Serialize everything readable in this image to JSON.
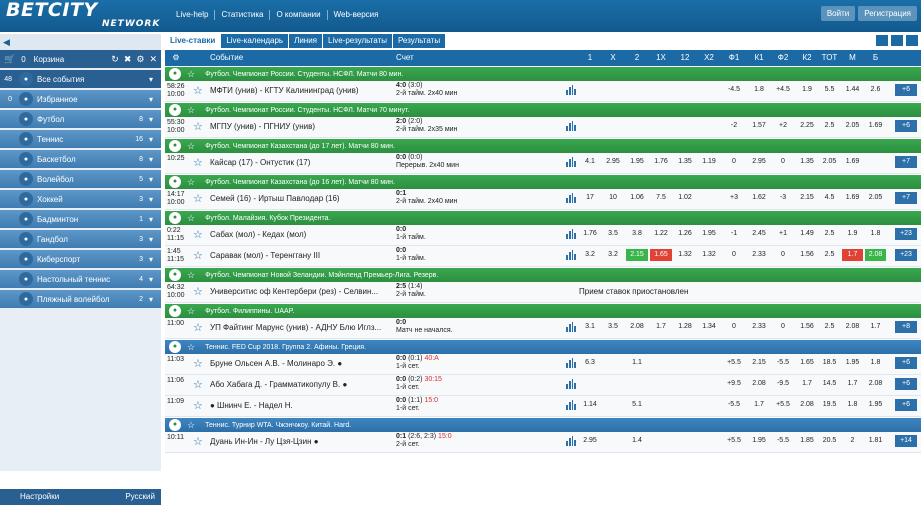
{
  "brand": {
    "name": "BETCITY",
    "sub": "NETWORK"
  },
  "topnav": [
    "Live-help",
    "Статистика",
    "О компании",
    "Web-версия"
  ],
  "auth": {
    "login": "Войти",
    "register": "Регистрация"
  },
  "sidebar": {
    "collapse_icon": "arrow-left-icon",
    "basket": {
      "count": "0",
      "label": "Корзина"
    },
    "items": [
      {
        "count": "48",
        "label": "Все события",
        "num": "",
        "icon": "list-icon",
        "selected": true
      },
      {
        "count": "0",
        "label": "Избранное",
        "num": "",
        "icon": "star-icon"
      },
      {
        "count": "",
        "label": "Футбол",
        "num": "8",
        "icon": "football-icon"
      },
      {
        "count": "",
        "label": "Теннис",
        "num": "16",
        "icon": "tennis-icon"
      },
      {
        "count": "",
        "label": "Баскетбол",
        "num": "8",
        "icon": "basketball-icon"
      },
      {
        "count": "",
        "label": "Волейбол",
        "num": "5",
        "icon": "volleyball-icon"
      },
      {
        "count": "",
        "label": "Хоккей",
        "num": "3",
        "icon": "hockey-icon"
      },
      {
        "count": "",
        "label": "Бадминтон",
        "num": "1",
        "icon": "badminton-icon"
      },
      {
        "count": "",
        "label": "Гандбол",
        "num": "3",
        "icon": "handball-icon"
      },
      {
        "count": "",
        "label": "Киберспорт",
        "num": "3",
        "icon": "esports-icon"
      },
      {
        "count": "",
        "label": "Настольный теннис",
        "num": "4",
        "icon": "table-tennis-icon"
      },
      {
        "count": "",
        "label": "Пляжный волейбол",
        "num": "2",
        "icon": "beach-volleyball-icon"
      }
    ],
    "settings": "Настройки",
    "language": "Русский"
  },
  "tabs": [
    "Live-ставки",
    "Live-календарь",
    "Линия",
    "Live-результаты",
    "Результаты"
  ],
  "header": {
    "event": "Событие",
    "score": "Счет",
    "cols": [
      "1",
      "X",
      "2",
      "1X",
      "12",
      "X2",
      "Ф1",
      "К1",
      "Ф2",
      "К2",
      "ТОТ",
      "М",
      "Б"
    ]
  },
  "colors": {
    "accent": "#1b6aa5",
    "league_green": "#2c8f40",
    "league_blue": "#2d6fa8",
    "odd_up": "#39b54a",
    "odd_down": "#e04236"
  },
  "rows": [
    {
      "type": "league",
      "color": "green",
      "text": "Футбол. Чемпионат России. Студенты. НСФЛ. Матчи 80 мин."
    },
    {
      "type": "event",
      "t1": "58:26",
      "t2": "10:00",
      "name": "МФТИ (унив) - КГТУ Калининград (унив)",
      "s1": "4:0",
      "s1x": "(3:0)",
      "s2": "2-й тайм. 2х40 мин",
      "odds": [
        "",
        "",
        "",
        "",
        "",
        "",
        "-4.5",
        "1.8",
        "+4.5",
        "1.9",
        "5.5",
        "1.44",
        "2.6"
      ],
      "plus": "+6"
    },
    {
      "type": "league",
      "color": "green",
      "text": "Футбол. Чемпионат России. Студенты. НСФЛ. Матчи 70 минут."
    },
    {
      "type": "event",
      "t1": "55:30",
      "t2": "10:00",
      "name": "МГПУ (унив) - ПГНИУ (унив)",
      "s1": "2:0",
      "s1x": "(2:0)",
      "s2": "2-й тайм. 2х35 мин",
      "odds": [
        "",
        "",
        "",
        "",
        "",
        "",
        "-2",
        "1.57",
        "+2",
        "2.25",
        "2.5",
        "2.05",
        "1.69"
      ],
      "plus": "+6"
    },
    {
      "type": "league",
      "color": "green",
      "text": "Футбол. Чемпионат Казахстана (до 17 лет). Матчи 80 мин."
    },
    {
      "type": "event",
      "t1": "10:25",
      "t2": "",
      "name": "Кайсар (17) - Онтустик (17)",
      "s1": "0:0",
      "s1x": "(0:0)",
      "s2": "Перерыв. 2х40 мин",
      "odds": [
        "4.1",
        "2.95",
        "1.95",
        "1.76",
        "1.35",
        "1.19",
        "0",
        "2.95",
        "0",
        "1.35",
        "2.05",
        "1.69"
      ],
      "plus": "+7"
    },
    {
      "type": "league",
      "color": "green",
      "text": "Футбол. Чемпионат Казахстана (до 16 лет). Матчи 80 мин."
    },
    {
      "type": "event",
      "t1": "14:17",
      "t2": "10:00",
      "name": "Семей (16) - Иртыш Павлодар (16)",
      "s1": "0:1",
      "s1x": "",
      "s2": "2-й тайм. 2х40 мин",
      "odds": [
        "17",
        "10",
        "1.06",
        "7.5",
        "1.02",
        "",
        "+3",
        "1.62",
        "-3",
        "2.15",
        "4.5",
        "1.69",
        "2.05"
      ],
      "plus": "+7"
    },
    {
      "type": "league",
      "color": "green",
      "text": "Футбол. Малайзия. Кубок Президента."
    },
    {
      "type": "event",
      "t1": "0:22",
      "t2": "11:15",
      "name": "Сабах (мол) - Кедах (мол)",
      "s1": "0:0",
      "s1x": "",
      "s2": "1-й тайм.",
      "odds": [
        "1.76",
        "3.5",
        "3.8",
        "1.22",
        "1.26",
        "1.95",
        "-1",
        "2.45",
        "+1",
        "1.49",
        "2.5",
        "1.9",
        "1.8"
      ],
      "plus": "+23"
    },
    {
      "type": "event",
      "t1": "1:45",
      "t2": "11:15",
      "name": "Саравак (мол) - Теренггану III",
      "s1": "0:0",
      "s1x": "",
      "s2": "1-й тайм.",
      "odds": [
        "3.2",
        "3.2",
        "2.15",
        "1.65",
        "1.32",
        "1.32",
        "0",
        "2.33",
        "0",
        "1.56",
        "2.5",
        "1.7",
        "2.08"
      ],
      "hl": {
        "2": "g",
        "3": "r",
        "11": "r",
        "12": "g"
      },
      "plus": "+23"
    },
    {
      "type": "league",
      "color": "green",
      "text": "Футбол. Чемпионат Новой Зеландии. Мэйнленд Премьер-Лига. Резерв."
    },
    {
      "type": "event",
      "t1": "64:32",
      "t2": "10:00",
      "name": "Университис оф Кентербери (рез) - Селвин...",
      "s1": "2:5",
      "s1x": "(1:4)",
      "s2": "2-й тайм.",
      "notice": "Прием ставок приостановлен",
      "odds": []
    },
    {
      "type": "league",
      "color": "green",
      "text": "Футбол. Филиппины. UAAP."
    },
    {
      "type": "event",
      "t1": "11:00",
      "t2": "",
      "name": "УП Файтинг Марунс (унив) - АДНУ Блю Иглз...",
      "s1": "0:0",
      "s1x": "",
      "s2": "Матч не начался.",
      "odds": [
        "3.1",
        "3.5",
        "2.08",
        "1.7",
        "1.28",
        "1.34",
        "0",
        "2.33",
        "0",
        "1.56",
        "2.5",
        "2.08",
        "1.7"
      ],
      "plus": "+8"
    },
    {
      "type": "league",
      "color": "blue",
      "text": "Теннис. FED Cup 2018. Группа 2. Афины. Греция."
    },
    {
      "type": "event",
      "t1": "11:03",
      "t2": "",
      "name": "Бруне Ольсен А.В. - Молинаро Э. ●",
      "s1": "0:0",
      "s1x": "(0:1)",
      "s1r": "40:A",
      "s2": "1-й сет.",
      "odds": [
        "6.3",
        "",
        "1.1",
        "",
        "",
        "",
        "+5.5",
        "2.15",
        "-5.5",
        "1.65",
        "18.5",
        "1.95",
        "1.8"
      ],
      "plus": "+6"
    },
    {
      "type": "event",
      "t1": "11:06",
      "t2": "",
      "name": "Або Хабага Д. - Грамматикопулу В. ●",
      "s1": "0:0",
      "s1x": "(0:2)",
      "s1r": "30:15",
      "s2": "1-й сет.",
      "odds": [
        "",
        "",
        "",
        "",
        "",
        "",
        "+9.5",
        "2.08",
        "-9.5",
        "1.7",
        "14.5",
        "1.7",
        "2.08"
      ],
      "plus": "+6"
    },
    {
      "type": "event",
      "t1": "11:09",
      "t2": "",
      "name": "● Шнинч Е. - Надел Н.",
      "s1": "0:0",
      "s1x": "(1:1)",
      "s1r": "15:0",
      "s2": "1-й сет.",
      "odds": [
        "1.14",
        "",
        "5.1",
        "",
        "",
        "",
        "-5.5",
        "1.7",
        "+5.5",
        "2.08",
        "19.5",
        "1.8",
        "1.95"
      ],
      "plus": "+6"
    },
    {
      "type": "league",
      "color": "blue",
      "text": "Теннис. Турнир WTA. Чжэнчжоу. Китай. Hard."
    },
    {
      "type": "event",
      "t1": "10:11",
      "t2": "",
      "name": "Дуань Ин-Ин - Лу Цзя-Цзин ●",
      "s1": "0:1",
      "s1x": "(2:6, 2:3)",
      "s1r": "15:0",
      "s2": "2-й сет.",
      "odds": [
        "2.95",
        "",
        "1.4",
        "",
        "",
        "",
        "+5.5",
        "1.95",
        "-5.5",
        "1.85",
        "20.5",
        "2",
        "1.81"
      ],
      "plus": "+14"
    }
  ]
}
